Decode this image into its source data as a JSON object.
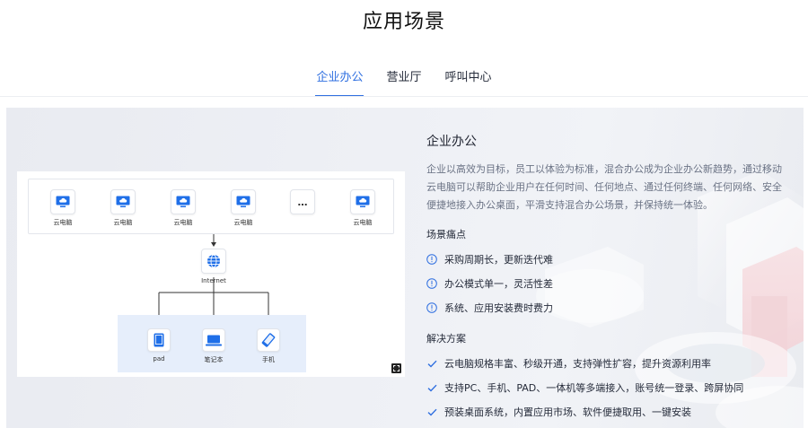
{
  "page": {
    "title": "应用场景"
  },
  "tabs": [
    {
      "label": "企业办公",
      "active": true
    },
    {
      "label": "营业厅",
      "active": false
    },
    {
      "label": "呼叫中心",
      "active": false
    }
  ],
  "scenario": {
    "title": "企业办公",
    "description": "企业以高效为目标，员工以体验为标准，混合办公成为企业办公新趋势，通过移动云电脑可以帮助企业用户在任何时间、任何地点、通过任何终端、任何网络、安全便捷地接入办公桌面，平滑支持混合办公场景，并保持统一体验。",
    "pain_points_title": "场景痛点",
    "pain_points": [
      "采购周期长，更新迭代难",
      "办公模式单一，灵活性差",
      "系统、应用安装费时费力"
    ],
    "solutions_title": "解决方案",
    "solutions": [
      "云电脑规格丰富、秒级开通，支持弹性扩容，提升资源利用率",
      "支持PC、手机、PAD、一体机等多端接入，账号统一登录、跨屏协同",
      "预装桌面系统，内置应用市场、软件便捷取用、一键安装"
    ]
  },
  "diagram": {
    "cloud_pcs": [
      "云电脑",
      "云电脑",
      "云电脑",
      "云电脑",
      "…",
      "云电脑"
    ],
    "network": "Internet",
    "endpoints": [
      "pad",
      "笔记本",
      "手机"
    ]
  },
  "colors": {
    "accent": "#2f6fe0",
    "icon_blue": "#1f6fe8"
  }
}
